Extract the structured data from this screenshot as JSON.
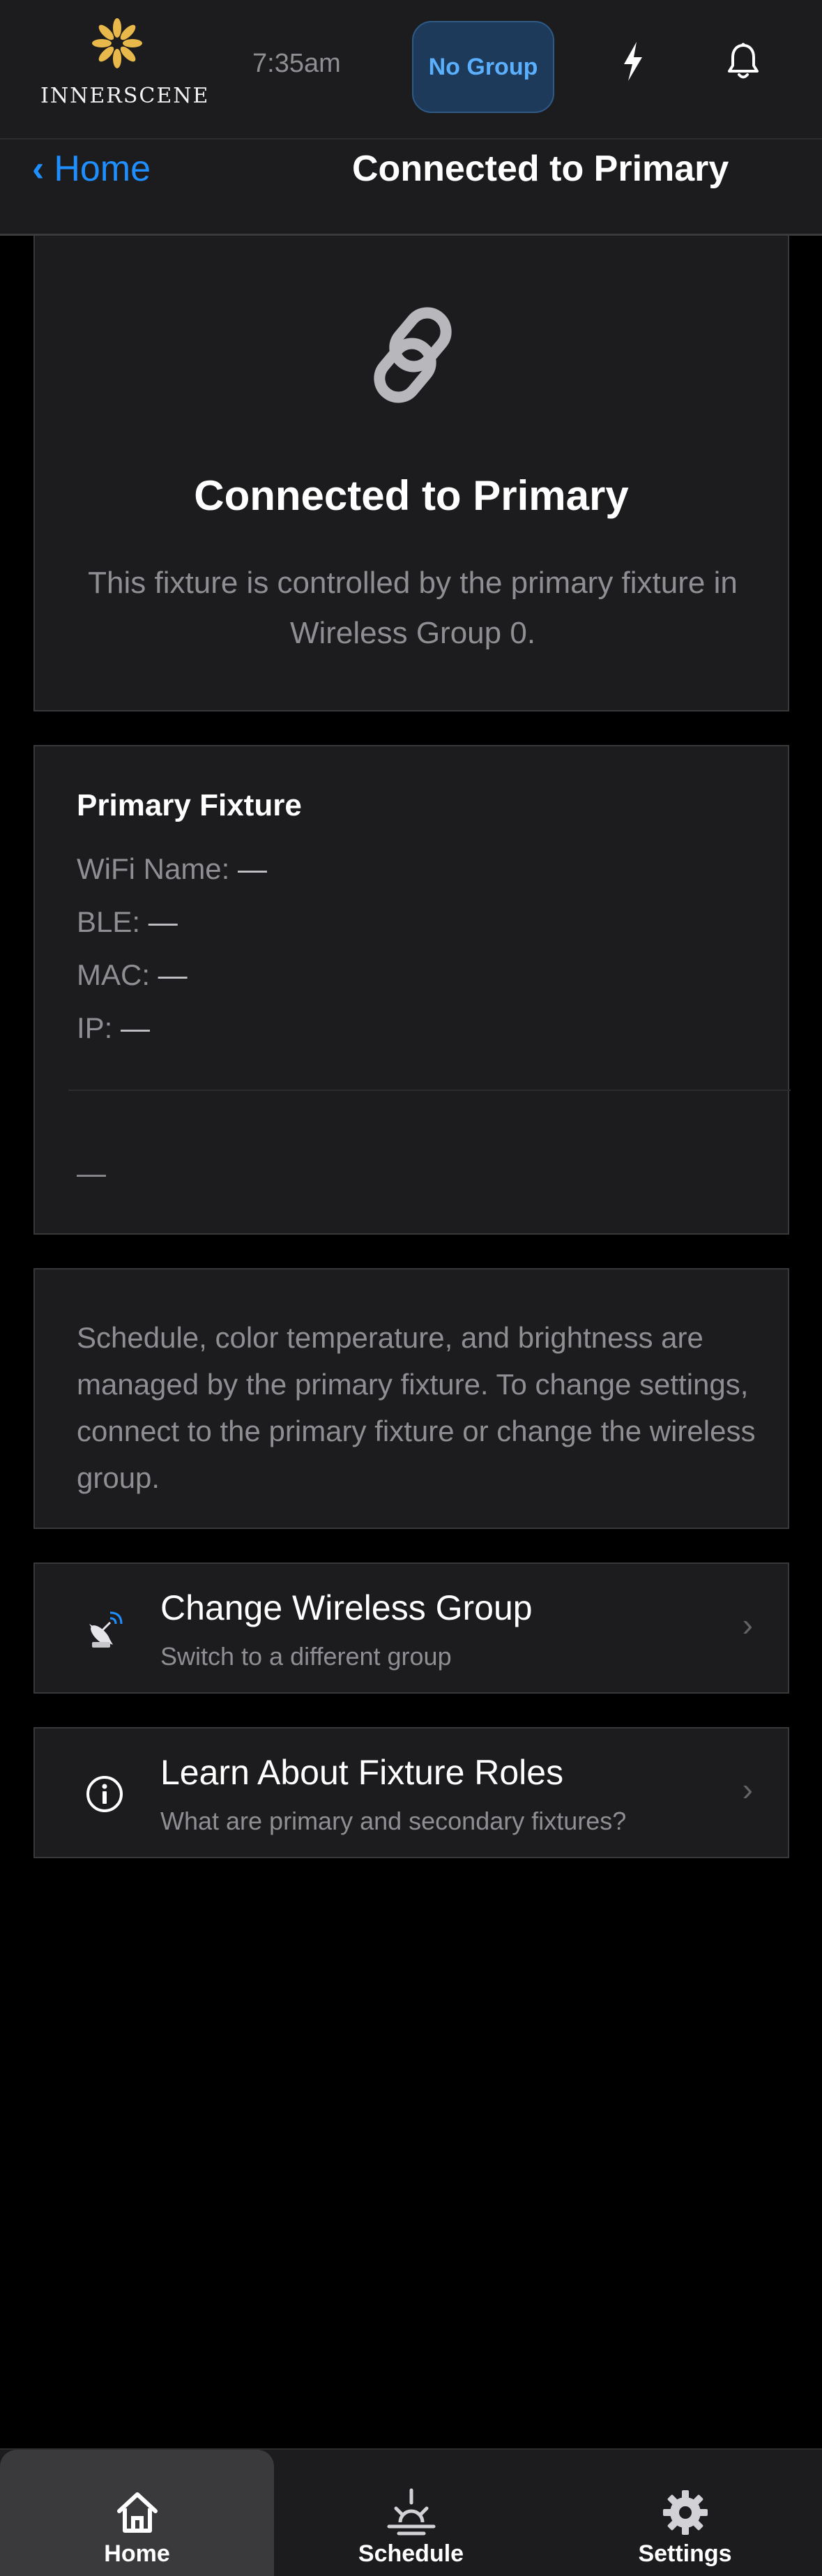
{
  "brand": {
    "name": "INNERSCENE",
    "logo_color": "#e8b84a"
  },
  "status": {
    "time": "7:35am",
    "group_label": "No Group"
  },
  "icons": {
    "bolt": "lightning-bolt-icon",
    "bell": "bell-icon",
    "hero": "chain-link-icon",
    "wireless": "satellite-dish-icon",
    "info": "info-circle-icon",
    "home": "home-icon",
    "schedule": "sunrise-icon",
    "settings": "gear-icon"
  },
  "nav": {
    "back_label": "Home",
    "title": "Connected to Primary"
  },
  "hero": {
    "title": "Connected to Primary",
    "description": "This fixture is controlled by the primary fixture in Wireless Group 0."
  },
  "primary_fixture": {
    "heading": "Primary Fixture",
    "rows": [
      {
        "label": "WiFi Name:",
        "value": "—"
      },
      {
        "label": "BLE:",
        "value": "—"
      },
      {
        "label": "MAC:",
        "value": "—"
      },
      {
        "label": "IP:",
        "value": "—"
      }
    ],
    "extra": "—"
  },
  "note": {
    "text": "Schedule, color temperature, and brightness are managed by the primary fixture. To change settings, connect to the primary fixture or change the wireless group."
  },
  "actions": [
    {
      "title": "Change Wireless Group",
      "subtitle": "Switch to a different group",
      "chevron": "›"
    },
    {
      "title": "Learn About Fixture Roles",
      "subtitle": "What are primary and secondary fixtures?",
      "chevron": "›"
    }
  ],
  "tabs": [
    {
      "label": "Home",
      "active": true
    },
    {
      "label": "Schedule",
      "active": false
    },
    {
      "label": "Settings",
      "active": false
    }
  ],
  "colors": {
    "accent": "#1f8fff",
    "pill_text": "#5ab0ff",
    "surface": "#1c1c1e",
    "muted_text": "#8e8e93"
  }
}
